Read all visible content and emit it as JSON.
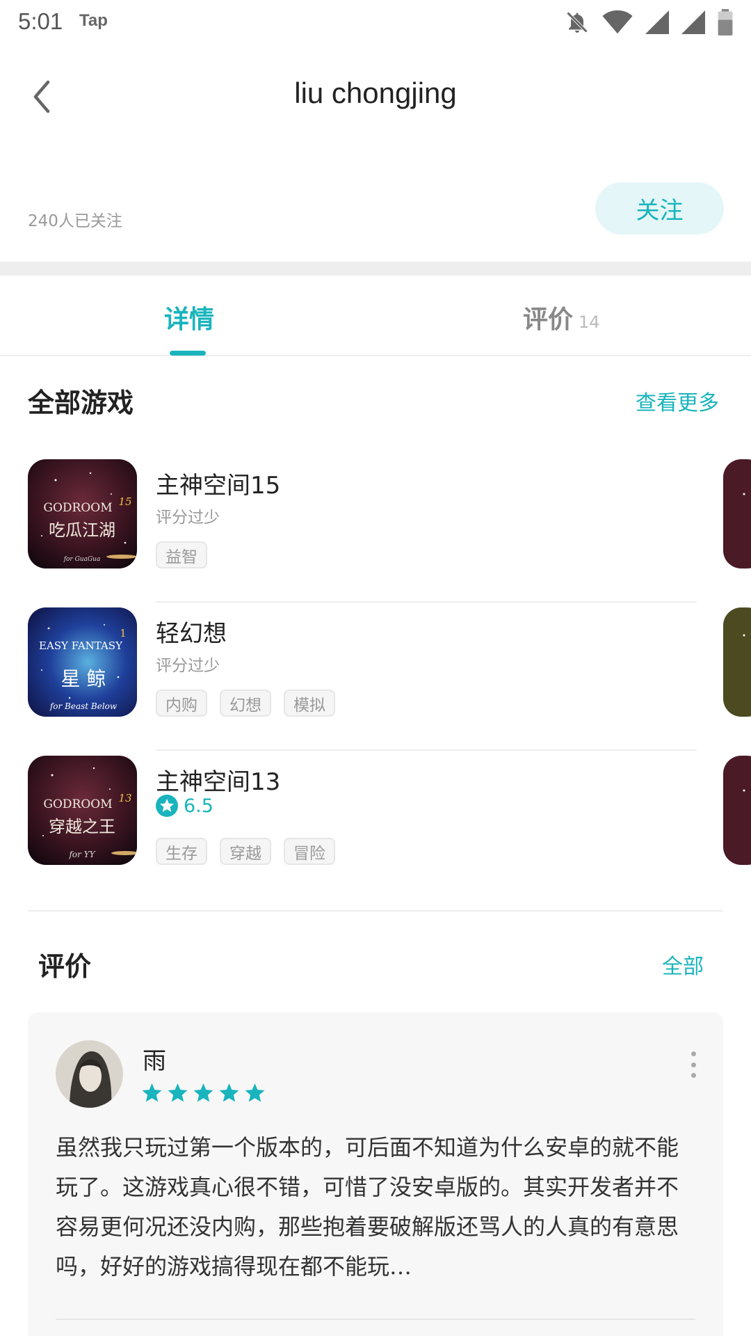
{
  "status_bar": {
    "time": "5:01",
    "app": "Tap",
    "icons": [
      "bell-off-icon",
      "wifi-icon",
      "signal-icon",
      "signal-icon",
      "battery-icon"
    ]
  },
  "header": {
    "title": "liu chongjing"
  },
  "profile": {
    "followers": "240人已关注",
    "follow_label": "关注"
  },
  "tabs": [
    {
      "label": "详情",
      "count": ""
    },
    {
      "label": "评价",
      "count": "14"
    }
  ],
  "games_section": {
    "title": "全部游戏",
    "more_label": "查看更多",
    "games": [
      {
        "name": "主神空间15",
        "rating_text": "评分过少",
        "rating": null,
        "tags": [
          "益智"
        ],
        "icon": {
          "line1": "GODROOM",
          "num": "15",
          "line2": "吃瓜江湖",
          "line3": "for GuaGua"
        }
      },
      {
        "name": "轻幻想",
        "rating_text": "评分过少",
        "rating": null,
        "tags": [
          "内购",
          "幻想",
          "模拟"
        ],
        "icon": {
          "line1": "EASY FANTASY",
          "num": "1",
          "line2": "星 鲸",
          "line3": "for Beast Below"
        }
      },
      {
        "name": "主神空间13",
        "rating_text": "",
        "rating": "6.5",
        "tags": [
          "生存",
          "穿越",
          "冒险"
        ],
        "icon": {
          "line1": "GODROOM",
          "num": "13",
          "line2": "穿越之王",
          "line3": "for YY"
        }
      }
    ]
  },
  "reviews_section": {
    "title": "评价",
    "all_label": "全部",
    "review": {
      "user": "雨",
      "stars": 5,
      "text": "虽然我只玩过第一个版本的，可后面不知道为什么安卓的就不能玩了。这游戏真心很不错，可惜了没安卓版的。其实开发者并不容易更何况还没内购，那些抱着要破解版还骂人的人真的有意思吗，好好的游戏搞得现在都不能玩…"
    }
  },
  "colors": {
    "accent": "#19b4bd",
    "follow_bg": "#e4f6f7",
    "text_primary": "#222222",
    "text_muted": "#999999"
  }
}
